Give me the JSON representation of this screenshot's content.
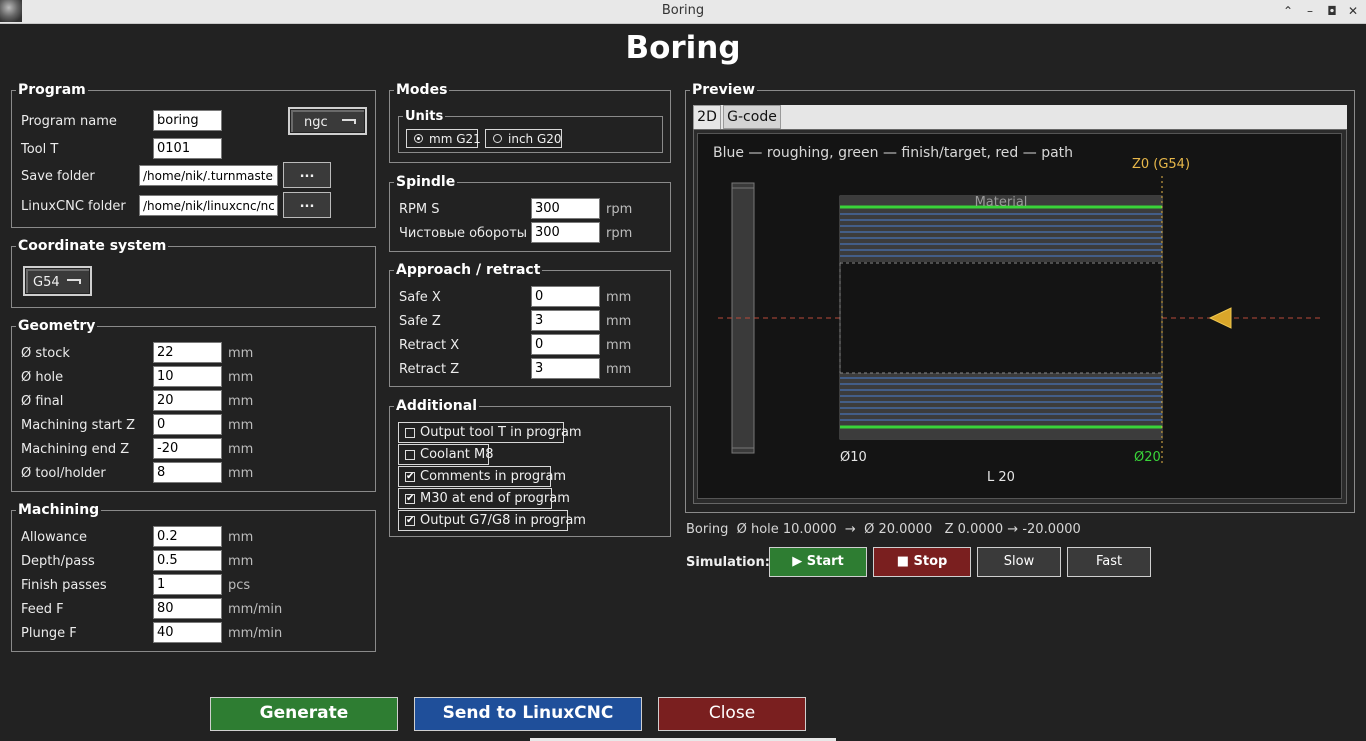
{
  "window": {
    "title": "Boring"
  },
  "page_title": "Boring",
  "program": {
    "legend": "Program",
    "name_label": "Program name",
    "name_value": "boring",
    "format_value": "ngc",
    "tool_label": "Tool T",
    "tool_value": "0101",
    "save_label": "Save folder",
    "save_value": "/home/nik/.turnmaster/ge",
    "linuxcnc_label": "LinuxCNC folder",
    "linuxcnc_value": "/home/nik/linuxcnc/nc_fil",
    "browse_label": "..."
  },
  "coord": {
    "legend": "Coordinate system",
    "value": "G54"
  },
  "geometry": {
    "legend": "Geometry",
    "rows": [
      {
        "label": "Ø stock",
        "value": "22",
        "unit": "mm"
      },
      {
        "label": "Ø hole",
        "value": "10",
        "unit": "mm"
      },
      {
        "label": "Ø final",
        "value": "20",
        "unit": "mm"
      },
      {
        "label": "Machining start Z",
        "value": "0",
        "unit": "mm"
      },
      {
        "label": "Machining end Z",
        "value": "-20",
        "unit": "mm"
      },
      {
        "label": "Ø tool/holder",
        "value": "8",
        "unit": "mm"
      }
    ]
  },
  "machining": {
    "legend": "Machining",
    "rows": [
      {
        "label": "Allowance",
        "value": "0.2",
        "unit": "mm"
      },
      {
        "label": "Depth/pass",
        "value": "0.5",
        "unit": "mm"
      },
      {
        "label": "Finish passes",
        "value": "1",
        "unit": "pcs"
      },
      {
        "label": "Feed F",
        "value": "80",
        "unit": "mm/min"
      },
      {
        "label": "Plunge F",
        "value": "40",
        "unit": "mm/min"
      }
    ]
  },
  "modes": {
    "legend": "Modes",
    "units_legend": "Units",
    "mm_label": "mm G21",
    "inch_label": "inch G20",
    "selected": "mm"
  },
  "spindle": {
    "legend": "Spindle",
    "rows": [
      {
        "label": "RPM S",
        "value": "300",
        "unit": "rpm"
      },
      {
        "label": "Чистовые обороты S",
        "value": "300",
        "unit": "rpm"
      }
    ]
  },
  "approach": {
    "legend": "Approach / retract",
    "rows": [
      {
        "label": "Safe X",
        "value": "0",
        "unit": "mm"
      },
      {
        "label": "Safe Z",
        "value": "3",
        "unit": "mm"
      },
      {
        "label": "Retract X",
        "value": "0",
        "unit": "mm"
      },
      {
        "label": "Retract Z",
        "value": "3",
        "unit": "mm"
      }
    ]
  },
  "additional": {
    "legend": "Additional",
    "items": [
      {
        "label": "Output tool T in program",
        "checked": false
      },
      {
        "label": "Coolant M8",
        "checked": false
      },
      {
        "label": "Comments in program",
        "checked": true
      },
      {
        "label": "M30 at end of program",
        "checked": true
      },
      {
        "label": "Output G7/G8 in program",
        "checked": true
      }
    ],
    "check_glyph": "✔"
  },
  "preview": {
    "legend": "Preview",
    "tabs": [
      "2D",
      "G-code"
    ],
    "active_tab": "2D",
    "caption": "Blue — roughing, green — finish/target, red — path",
    "z0_label": "Z0 (G54)",
    "material_label": "Material",
    "dia_hole_label": "Ø10",
    "dia_final_label": "Ø20",
    "length_label": "L 20",
    "colors": {
      "roughing": "#4a7fd4",
      "finish": "#39d439",
      "path": "#d94a3a",
      "z0": "#e8b84a",
      "tool": "#e0b030"
    }
  },
  "summary": {
    "op": "Boring",
    "hole": "Ø hole 10.0000",
    "arrow1": "→",
    "final": "Ø 20.0000",
    "z": "Z 0.0000",
    "arrow2": "→",
    "zend": "-20.0000"
  },
  "simulation": {
    "label": "Simulation:",
    "start": "▶ Start",
    "stop": "■ Stop",
    "slow": "Slow",
    "fast": "Fast"
  },
  "actions": {
    "generate": "Generate",
    "send": "Send to LinuxCNC",
    "close": "Close"
  }
}
